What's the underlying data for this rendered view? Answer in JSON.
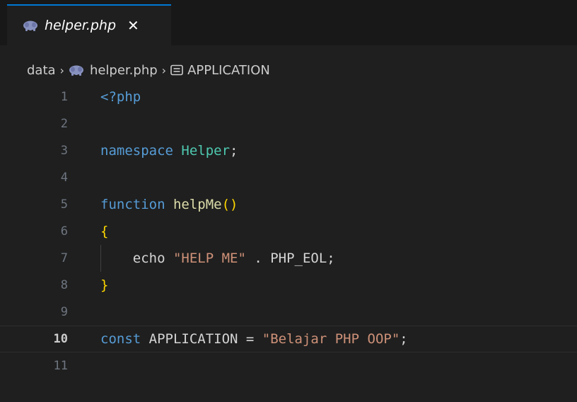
{
  "tab": {
    "label": "helper.php",
    "close_glyph": "✕",
    "icon": "php-elephant-icon"
  },
  "breadcrumb": {
    "folder": "data",
    "file": "helper.php",
    "symbol": "APPLICATION",
    "separator": "›",
    "symbol_icon": "constant-symbol-icon"
  },
  "editor": {
    "current_line": 10,
    "lines": [
      {
        "n": "1",
        "tokens": [
          {
            "t": "<?php",
            "c": "kw"
          }
        ]
      },
      {
        "n": "2",
        "tokens": []
      },
      {
        "n": "3",
        "tokens": [
          {
            "t": "namespace",
            "c": "kw"
          },
          {
            "t": " ",
            "c": "plain"
          },
          {
            "t": "Helper",
            "c": "ns"
          },
          {
            "t": ";",
            "c": "plain"
          }
        ]
      },
      {
        "n": "4",
        "tokens": []
      },
      {
        "n": "5",
        "tokens": [
          {
            "t": "function",
            "c": "kw"
          },
          {
            "t": " ",
            "c": "plain"
          },
          {
            "t": "helpMe",
            "c": "fn"
          },
          {
            "t": "()",
            "c": "br"
          }
        ]
      },
      {
        "n": "6",
        "tokens": [
          {
            "t": "{",
            "c": "br"
          }
        ]
      },
      {
        "n": "7",
        "tokens": [
          {
            "t": "    echo ",
            "c": "plain"
          },
          {
            "t": "\"HELP ME\"",
            "c": "str"
          },
          {
            "t": " . PHP_EOL;",
            "c": "plain"
          }
        ],
        "guide": true
      },
      {
        "n": "8",
        "tokens": [
          {
            "t": "}",
            "c": "br"
          }
        ]
      },
      {
        "n": "9",
        "tokens": []
      },
      {
        "n": "10",
        "tokens": [
          {
            "t": "const",
            "c": "kw"
          },
          {
            "t": " APPLICATION = ",
            "c": "plain"
          },
          {
            "t": "\"Belajar PHP OOP\"",
            "c": "str"
          },
          {
            "t": ";",
            "c": "plain"
          }
        ]
      },
      {
        "n": "11",
        "tokens": []
      }
    ]
  },
  "colors": {
    "background": "#1f1f1f",
    "tab_accent": "#0078d4",
    "keyword": "#569cd6",
    "namespace": "#4ec9b0",
    "function": "#dcdcaa",
    "bracket": "#ffd700",
    "string": "#ce9178",
    "php_icon": "#8892bf"
  }
}
